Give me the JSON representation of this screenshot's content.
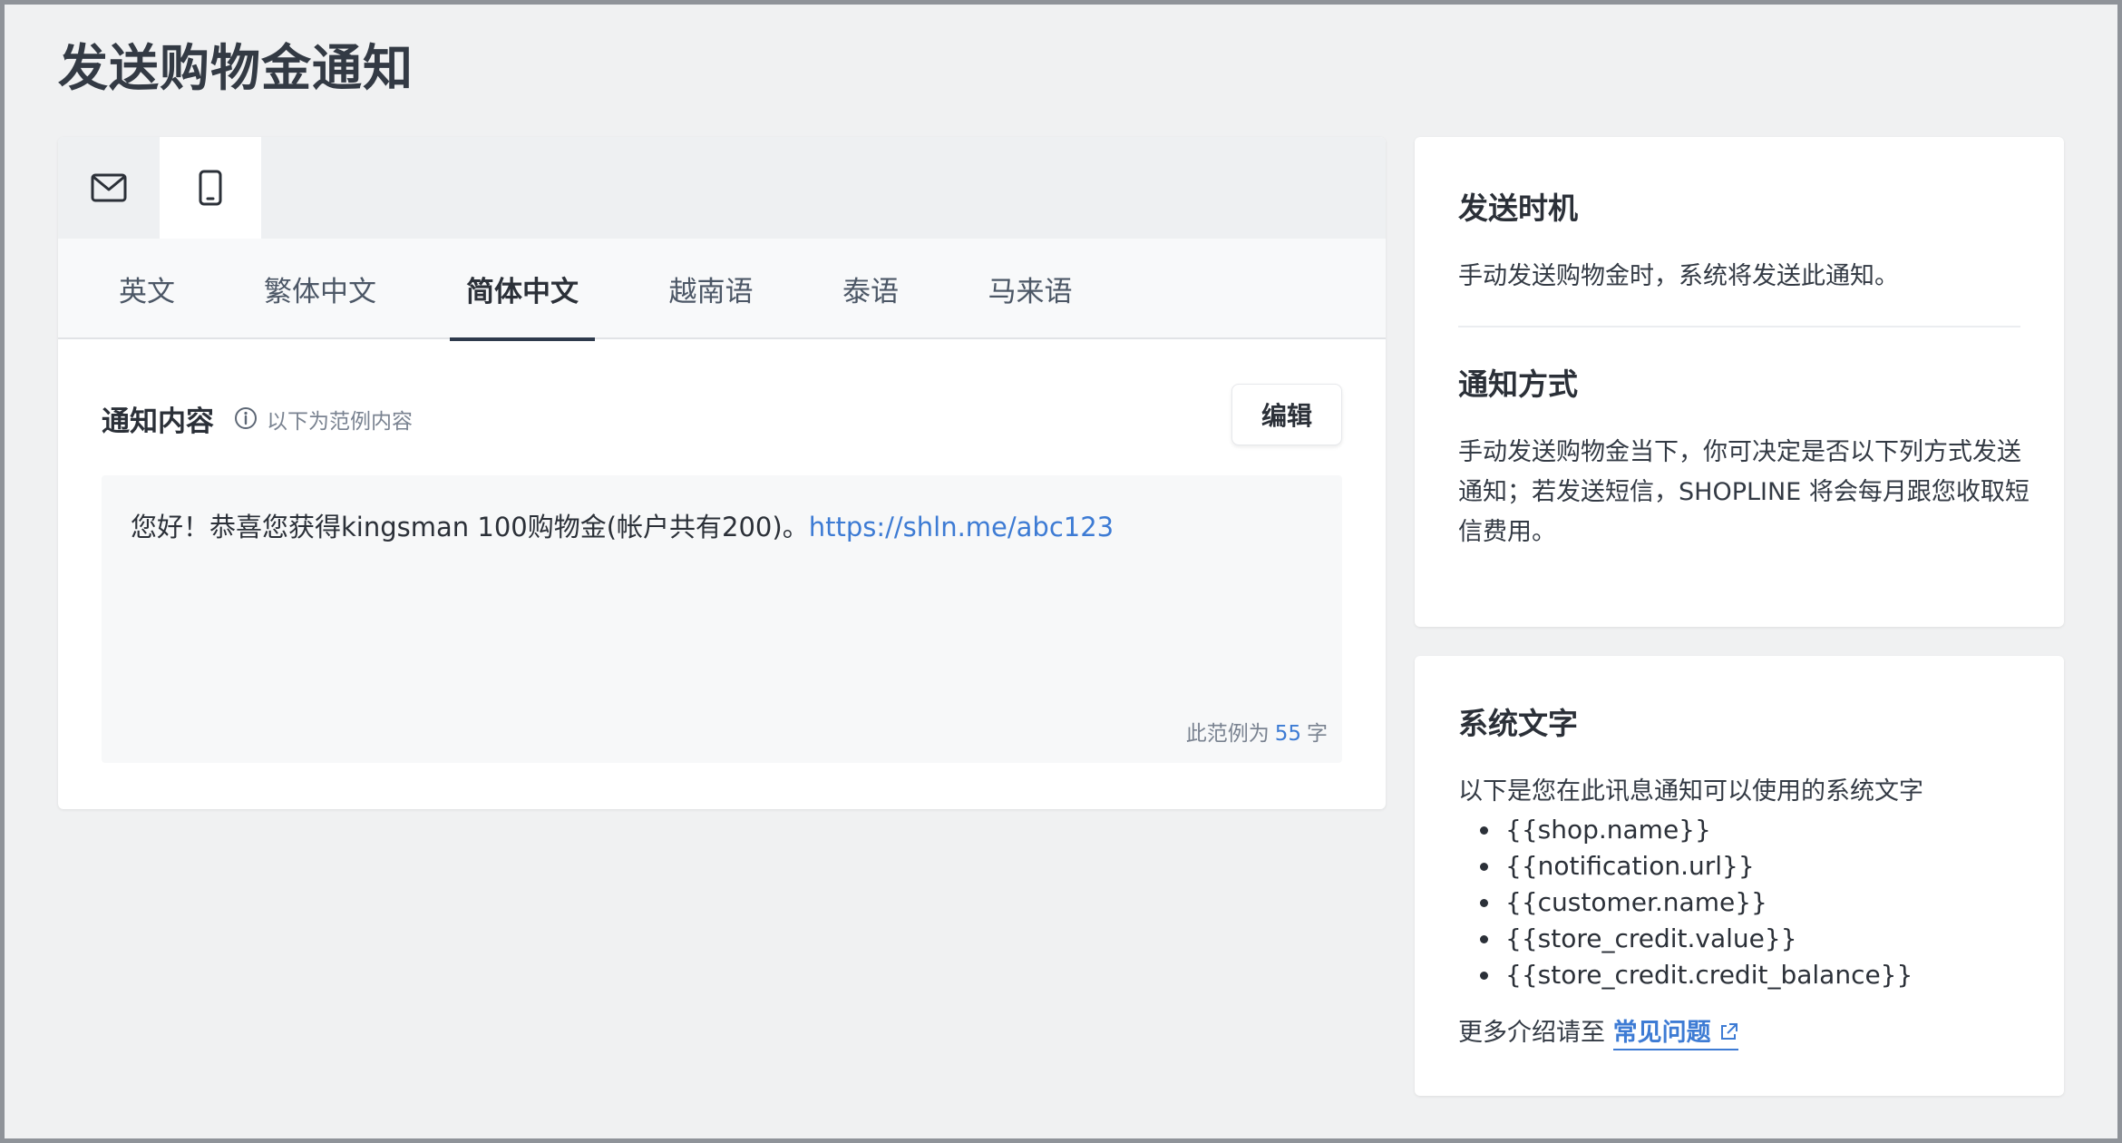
{
  "page": {
    "title": "发送购物金通知"
  },
  "channels": [
    {
      "name": "email",
      "icon": "mail-icon",
      "active": false
    },
    {
      "name": "sms",
      "icon": "mobile-phone-icon",
      "active": true
    }
  ],
  "languages": {
    "tabs": [
      "英文",
      "繁体中文",
      "简体中文",
      "越南语",
      "泰语",
      "马来语"
    ],
    "active": "简体中文"
  },
  "content": {
    "label": "通知内容",
    "hint": "以下为范例内容",
    "edit_label": "编辑",
    "message_text": "您好！恭喜您获得kingsman 100购物金(帐户共有200)。",
    "message_link": "https://shln.me/abc123",
    "count_prefix": "此范例为",
    "count_value": "55",
    "count_suffix": "字"
  },
  "timing": {
    "title": "发送时机",
    "text": "手动发送购物金时，系统将发送此通知。"
  },
  "method": {
    "title": "通知方式",
    "text": "手动发送购物金当下，你可决定是否以下列方式发送通知；若发送短信，SHOPLINE 将会每月跟您收取短信费用。"
  },
  "system_vars": {
    "title": "系统文字",
    "intro": "以下是您在此讯息通知可以使用的系统文字",
    "items": [
      "{{shop.name}}",
      "{{notification.url}}",
      "{{customer.name}}",
      "{{store_credit.value}}",
      "{{store_credit.credit_balance}}"
    ],
    "more_prefix": "更多介绍请至",
    "faq_label": "常见问题"
  },
  "colors": {
    "accent": "#3d7bd4",
    "active_tab_underline": "#2e3a4c",
    "background": "#f0f1f2"
  }
}
